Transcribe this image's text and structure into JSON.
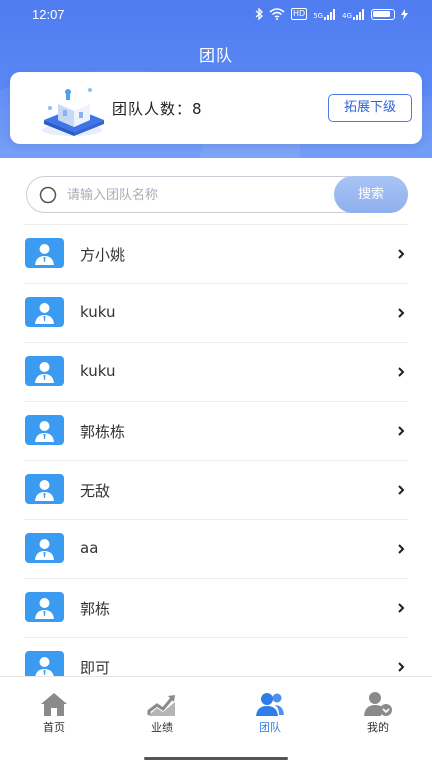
{
  "status_bar": {
    "time": "12:07",
    "icons": [
      "bluetooth-icon",
      "wifi-icon",
      "hd-icon",
      "signal-4g-icon",
      "signal-icon",
      "battery-icon",
      "charging-icon"
    ],
    "hd": "HD",
    "sig1": "5G",
    "sig2": "4G"
  },
  "header": {
    "title": "团队",
    "team_count_label": "团队人数：8",
    "expand_button": "拓展下级"
  },
  "search": {
    "placeholder": "请输入团队名称",
    "value": "",
    "button_label": "搜索"
  },
  "members": [
    {
      "name": "方小姚"
    },
    {
      "name": "kuku"
    },
    {
      "name": "kuku"
    },
    {
      "name": "郭栋栋"
    },
    {
      "name": "无敌"
    },
    {
      "name": "aa"
    },
    {
      "name": "郭栋"
    },
    {
      "name": "即可"
    }
  ],
  "tabs": [
    {
      "label": "首页",
      "icon": "home-icon",
      "active": false
    },
    {
      "label": "业绩",
      "icon": "chart-icon",
      "active": false
    },
    {
      "label": "团队",
      "icon": "team-icon",
      "active": true
    },
    {
      "label": "我的",
      "icon": "profile-icon",
      "active": false
    }
  ],
  "colors": {
    "header_blue": "#4f7df0",
    "accent": "#2f7ee8",
    "avatar_blue": "#3b9bf0"
  }
}
